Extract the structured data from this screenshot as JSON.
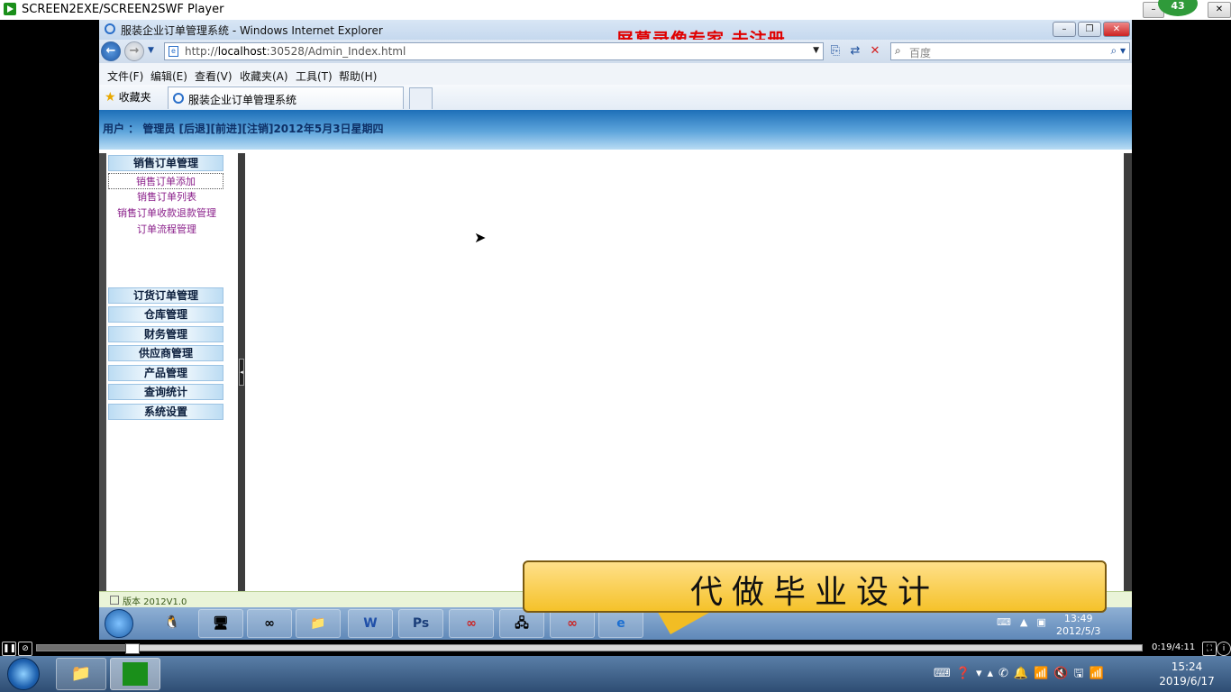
{
  "player": {
    "title": "SCREEN2EXE/SCREEN2SWF Player",
    "badge": "43",
    "time": "0:19/4:11",
    "progress": 0.08
  },
  "ie": {
    "title": "服装企业订单管理系统 - Windows Internet Explorer",
    "watermark": "屏幕录像专家  未注册",
    "url_prefix": "http://",
    "url_host": "localhost",
    "url_rest": ":30528/Admin_Index.html",
    "search_placeholder": "百度",
    "menu": [
      "文件(F)",
      "编辑(E)",
      "查看(V)",
      "收藏夹(A)",
      "工具(T)",
      "帮助(H)"
    ],
    "favorites": "收藏夹",
    "tab_title": "服装企业订单管理系统"
  },
  "page": {
    "user_info": "用户 ： 管理员    [后退][前进][注销]2012年5月3日星期四",
    "sidebar": {
      "sales_header": "销售订单管理",
      "sales_links": [
        "销售订单添加",
        "销售订单列表",
        "销售订单收款退款管理",
        "订单流程管理"
      ],
      "sections": [
        "订货订单管理",
        "仓库管理",
        "财务管理",
        "供应商管理",
        "产品管理",
        "查询统计",
        "系统设置"
      ]
    },
    "version": "版本 2012V1.0"
  },
  "inner_taskbar": {
    "time": "13:49",
    "date": "2012/5/3",
    "apps": [
      "W",
      "Ps",
      "∞",
      "e"
    ]
  },
  "ad": {
    "text": "代做毕业设计"
  },
  "taskbar": {
    "time": "15:24",
    "date": "2019/6/17"
  }
}
